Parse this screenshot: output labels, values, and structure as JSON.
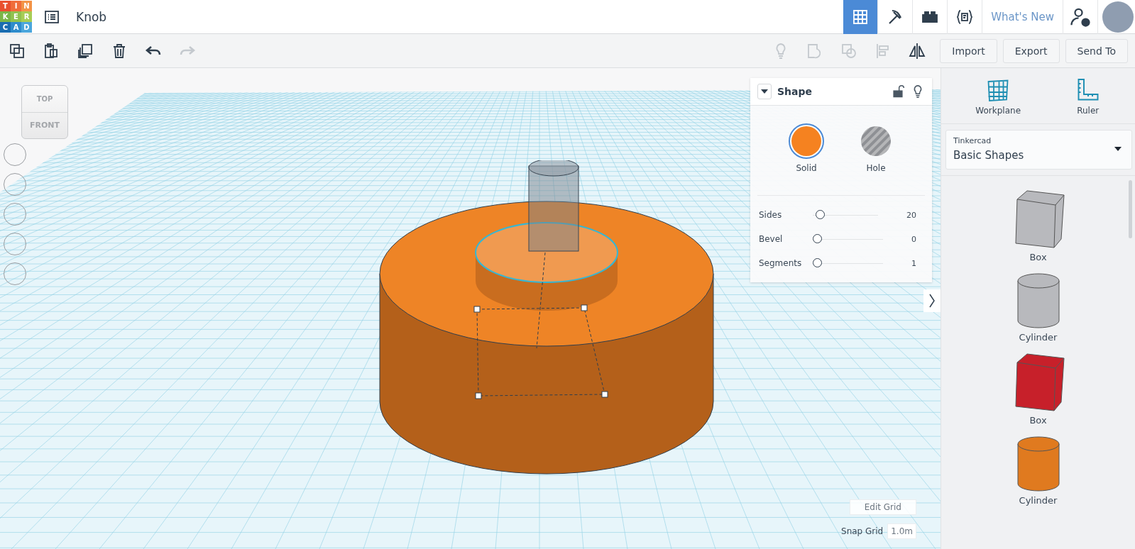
{
  "logo": {
    "letters": [
      {
        "char": "T",
        "color": "#e9502e"
      },
      {
        "char": "I",
        "color": "#f06d3a"
      },
      {
        "char": "N",
        "color": "#f39346"
      },
      {
        "char": "K",
        "color": "#7ab648"
      },
      {
        "char": "E",
        "color": "#91c24f"
      },
      {
        "char": "R",
        "color": "#a7cd55"
      },
      {
        "char": "C",
        "color": "#1a6db1"
      },
      {
        "char": "A",
        "color": "#2f8ccc"
      },
      {
        "char": "D",
        "color": "#4ba6dc"
      }
    ]
  },
  "title": "Knob",
  "nav": {
    "views": [
      {
        "kind": "grid",
        "selected": true
      },
      {
        "kind": "pickaxe",
        "selected": false
      },
      {
        "kind": "brick",
        "selected": false
      },
      {
        "kind": "codeblocks",
        "selected": false
      }
    ],
    "whats_new": "What's New"
  },
  "toolbar": {
    "edit_tools": [
      {
        "kind": "copy",
        "disabled": false
      },
      {
        "kind": "paste",
        "disabled": false
      },
      {
        "kind": "duplicate",
        "disabled": false
      },
      {
        "kind": "delete",
        "disabled": false
      },
      {
        "kind": "undo",
        "disabled": false
      },
      {
        "kind": "redo",
        "disabled": true
      }
    ],
    "shape_tools": [
      {
        "kind": "bulb",
        "disabled": true
      },
      {
        "kind": "group",
        "disabled": true
      },
      {
        "kind": "ungroup",
        "disabled": true
      },
      {
        "kind": "align",
        "disabled": true
      },
      {
        "kind": "mirror",
        "disabled": false
      }
    ],
    "buttons": [
      "Import",
      "Export",
      "Send To"
    ]
  },
  "view_cube": {
    "top": "TOP",
    "front": "FRONT"
  },
  "inspector": {
    "title": "Shape",
    "modes": [
      {
        "kind": "solid",
        "label": "Solid",
        "selected": true
      },
      {
        "kind": "hole",
        "label": "Hole",
        "selected": false
      }
    ],
    "params": [
      {
        "label": "Sides",
        "value": "20",
        "level": 0.05
      },
      {
        "label": "Bevel",
        "value": "0",
        "level": 0
      },
      {
        "label": "Segments",
        "value": "1",
        "level": 0
      }
    ]
  },
  "grid_controls": {
    "edit": "Edit Grid",
    "snap_label": "Snap Grid",
    "snap_value": "1.0m"
  },
  "side_panel": {
    "tools": [
      {
        "kind": "workplane",
        "label": "Workplane"
      },
      {
        "kind": "ruler",
        "label": "Ruler"
      }
    ],
    "library": {
      "source": "Tinkercad",
      "name": "Basic Shapes"
    },
    "shapes": [
      {
        "kind": "box",
        "label": "Box",
        "color": "#b8b9bd"
      },
      {
        "kind": "cylinder",
        "label": "Cylinder",
        "color": "#b8b9bd"
      },
      {
        "kind": "box",
        "label": "Box",
        "color": "#c7202a"
      },
      {
        "kind": "cylinder",
        "label": "Cylinder",
        "color": "#e07a1f"
      }
    ]
  }
}
